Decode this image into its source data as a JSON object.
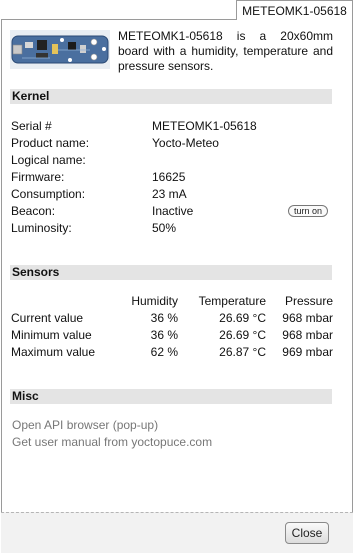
{
  "window": {
    "tab_title": "METEOMK1-05618"
  },
  "header": {
    "description": "METEOMK1-05618 is a 20x60mm board with a humidity, temperature and pressure sensors."
  },
  "kernel": {
    "title": "Kernel",
    "rows": [
      {
        "label": "Serial #",
        "value": "METEOMK1-05618"
      },
      {
        "label": "Product name:",
        "value": "Yocto-Meteo"
      },
      {
        "label": "Logical name:",
        "value": ""
      },
      {
        "label": "Firmware:",
        "value": "16625"
      },
      {
        "label": "Consumption:",
        "value": "23 mA"
      },
      {
        "label": "Beacon:",
        "value": "Inactive"
      },
      {
        "label": "Luminosity:",
        "value": "50%"
      }
    ],
    "beacon_button": "turn on"
  },
  "sensors": {
    "title": "Sensors",
    "columns": [
      "Humidity",
      "Temperature",
      "Pressure"
    ],
    "rows": [
      {
        "label": "Current value",
        "values": [
          "36 %",
          "26.69 °C",
          "968 mbar"
        ]
      },
      {
        "label": "Minimum value",
        "values": [
          "36 %",
          "26.69 °C",
          "968 mbar"
        ]
      },
      {
        "label": "Maximum value",
        "values": [
          "62 %",
          "26.87 °C",
          "969 mbar"
        ]
      }
    ]
  },
  "misc": {
    "title": "Misc",
    "links": [
      "Open API browser (pop-up)",
      "Get user manual from yoctopuce.com"
    ]
  },
  "footer": {
    "close_label": "Close"
  },
  "icons": {
    "board": "yocto-meteo-board-icon"
  },
  "colors": {
    "section_bg": "#e4e4e4",
    "link": "#777777",
    "border": "#9a9a9a"
  }
}
